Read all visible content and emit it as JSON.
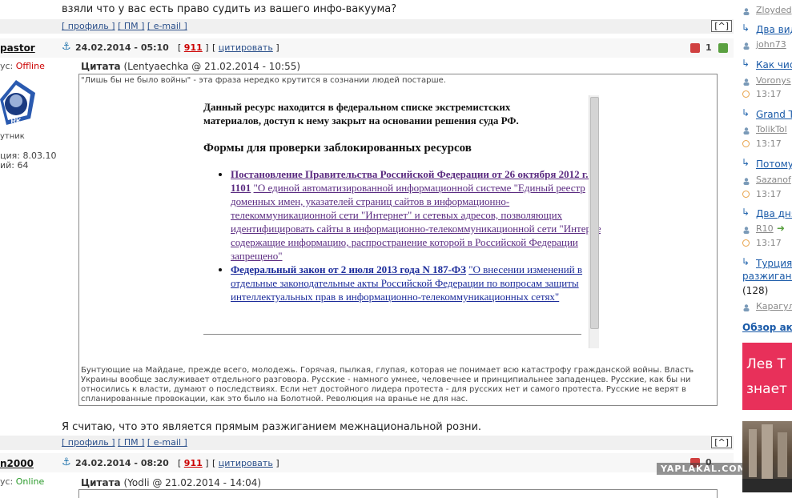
{
  "post1": {
    "text_tail": "взяли что у вас есть право судить из вашего инфо-вакуума?",
    "actions": [
      "[ профиль ]",
      "[ ПМ ]",
      "[ e-mail ]"
    ],
    "collapse": "[^]"
  },
  "post2": {
    "username": "pastor",
    "status_label": "ус:",
    "status_value": "Offline",
    "rank": "утник",
    "reg": "ция: 8.03.10",
    "posts": "ий: 64",
    "date": "24.02.2014 - 05:10",
    "number": "911",
    "quote_link": "цитировать",
    "rating": "1",
    "quote_header": "Цитата",
    "quote_author": "(Lentyaechka @ 21.02.2014 - 10:55)",
    "inner_quote": "\"Лишь бы не было войны\" - эта фраза нередко крутится в сознании людей постарше.",
    "blocked_notice": "Данный ресурс находится в федеральном списке экстремистских материалов, доступ к нему закрыт на основании решения суда РФ.",
    "forms_title": "Формы для проверки заблокированных ресурсов",
    "law1_title": "Постановление Правительства Российской Федерации от 26 октября 2012 г. N 1101",
    "law1_desc": "\"О единой автоматизированной информационной системе \"Единый реестр доменных имен, указателей страниц сайтов в информационно-телекоммуникационной сети \"Интернет\" и сетевых адресов, позволяющих идентифицировать сайты в информационно-телекоммуникационной сети \"Интернет\", содержащие информацию, распространение которой в Российской Федерации запрещено\"",
    "law2_title": "Федеральный закон от 2 июля 2013 года N 187-ФЗ",
    "law2_desc": "\"О внесении изменений в отдельные законодательные акты Российской Федерации по вопросам защиты интеллектуальных прав в информационно-телекоммуникационных сетях\"",
    "quote_bottom": "Бунтующие на Майдане, прежде всего, молодежь. Горячая, пылкая, глупая, которая не понимает всю катастрофу гражданской войны. Власть Украины вообще заслуживает отдельного разговора. Русские - намного умнее, человечнее и принципиальнее западенцев. Русские, как бы ни относились к власти, думают о последствиях. Если нет достойного лидера протеста - для русских нет и самого протеста. Русские не верят в спланированные провокации, как это было на Болотной. Революция на вранье не для нас.",
    "reply_text": "Я считаю, что это является прямым разжиганием межнациональной розни.",
    "actions": [
      "[ профиль ]",
      "[ ПМ ]",
      "[ e-mail ]"
    ],
    "collapse": "[^]"
  },
  "post3": {
    "username": "n2000",
    "status_label": "ус:",
    "status_value": "Online",
    "date": "24.02.2014 - 08:20",
    "number": "911",
    "quote_link": "цитировать",
    "rating": "0",
    "quote_header": "Цитата",
    "quote_author": "(Yodli @ 21.02.2014 - 14:04)"
  },
  "sidebar": {
    "items": [
      {
        "title": "Два вид",
        "user": "john73",
        "time": ""
      },
      {
        "title": "Как чис",
        "user": "Voronys",
        "time": "13:17"
      },
      {
        "title": "Grand T",
        "user": "TolikTol",
        "time": "13:17"
      },
      {
        "title": "Потому ч",
        "user": "Sazanof",
        "time": "13:17"
      },
      {
        "title": "Два дня",
        "user": "R10",
        "time": "13:17"
      },
      {
        "title": "Турция",
        "title2": "разжигание",
        "count": "(128)",
        "user": "Карагул",
        "time": ""
      }
    ],
    "top_user": "Zloyded",
    "review_link": "Обзор акт",
    "promo": "Лев Т знает"
  },
  "watermark": "YAPLAKAL.COM",
  "colors": {
    "accent": "#2a4f8a",
    "offline": "#cc0000",
    "online": "#2a9a2a",
    "number": "#cc0000"
  }
}
